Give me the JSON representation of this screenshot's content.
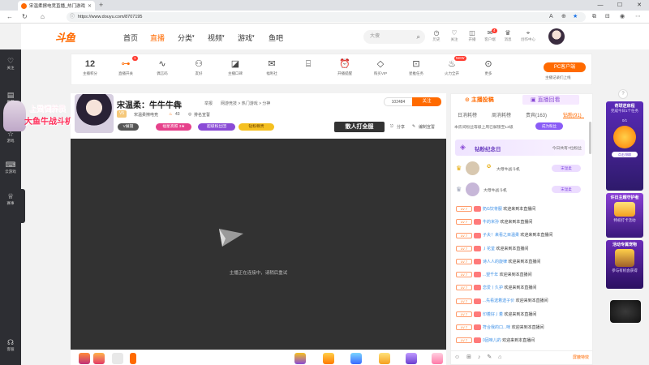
{
  "browser": {
    "tab_title": "宋温柔擦电竞直播_热门游戏兰...",
    "new_tab": "+",
    "url": "https://www.douyu.com/8707195",
    "window_controls": [
      "—",
      "☐",
      "✕"
    ]
  },
  "site": {
    "logo_text": "斗鱼",
    "nav": [
      {
        "label": "首页",
        "active": false
      },
      {
        "label": "直播",
        "active": true
      },
      {
        "label": "分类",
        "active": false
      },
      {
        "label": "视频",
        "active": false
      },
      {
        "label": "游戏",
        "active": false
      },
      {
        "label": "鱼吧",
        "active": false
      }
    ],
    "search_placeholder": "大傻",
    "header_icons": [
      {
        "icon": "history-icon",
        "label": "历史"
      },
      {
        "icon": "heart-icon",
        "label": "关注"
      },
      {
        "icon": "broadcast-icon",
        "label": "开播"
      },
      {
        "icon": "message-icon",
        "label": "客户端",
        "badge": "4"
      },
      {
        "icon": "medal-icon",
        "label": "消息"
      },
      {
        "icon": "location-icon",
        "label": "创作中心"
      }
    ]
  },
  "left_sidebar": [
    {
      "icon": "heart-icon",
      "label": "关注"
    },
    {
      "icon": "document-icon",
      "label": "推荐"
    },
    {
      "icon": "star-icon",
      "label": "游戏"
    },
    {
      "icon": "gamepad-icon",
      "label": "云游戏"
    },
    {
      "icon": "trophy-icon",
      "label": "赛事"
    },
    {
      "icon": "headset-icon",
      "label": "客服"
    }
  ],
  "toolbar": {
    "level": "12",
    "level_label": "主播积分",
    "items": [
      {
        "icon": "toggle-icon",
        "label": "直播开关",
        "badge": "1"
      },
      {
        "icon": "pulse-icon",
        "label": "偶言码"
      },
      {
        "icon": "users-icon",
        "label": "友好"
      },
      {
        "icon": "gift-box-icon",
        "label": "主播口碑"
      },
      {
        "icon": "gift-icon",
        "label": "福利社"
      },
      {
        "icon": "clock-icon",
        "label": "开播提醒"
      },
      {
        "icon": "diamond-icon",
        "label": "购买VIP"
      },
      {
        "icon": "ad-icon",
        "label": "星推任务"
      },
      {
        "icon": "fire-icon",
        "label": "火力全开",
        "badge": "NEW"
      },
      {
        "icon": "more-icon",
        "label": "更多"
      }
    ],
    "pc_client": "PC客户端",
    "pc_sub": "主播记录们上线"
  },
  "promo": {
    "line1": "上周饲养员",
    "line2": "大鱼牛战斗机"
  },
  "streamer": {
    "name": "宋温柔：牛牛牛犇",
    "report": "举报",
    "category": "网游竞技 > 热门游戏 > 分神",
    "tag": "宋温柔擦电竞",
    "fans": "43",
    "medal": "排名宣誓",
    "level_tag": "V5",
    "hot": "102484",
    "follow": "关注",
    "pills": [
      {
        "text": "V展翅",
        "color": "#555"
      },
      {
        "text": "福星高照 3★",
        "color": "#e6418b"
      },
      {
        "text": "超级粉丝团",
        "color": "#8a4bd6"
      },
      {
        "text": "钻粉尊贵",
        "color": "#f5c020"
      }
    ],
    "fan_button": "散人打全服",
    "share": "分享",
    "edit": "编制宣誓"
  },
  "video": {
    "message": "主播正在连接中，请稍后重试"
  },
  "chat": {
    "tabs": [
      "主播投稿",
      "直播回看"
    ],
    "rank_tabs": [
      {
        "label": "日消耗榜",
        "on": false
      },
      {
        "label": "周消耗榜",
        "on": false
      },
      {
        "label": "贵宾(163)",
        "on": false
      },
      {
        "label": "钻粉(91)",
        "on": true
      }
    ],
    "notice": "本房间粉丝等级上周已解锁至13级",
    "notice_btn": "成为粉丝",
    "commem_title": "钻粉纪念日",
    "commem_right": "今日共有7位粉丝",
    "users": [
      {
        "name": "大母牛战斗机",
        "tag": "宋温柔"
      },
      {
        "name": "大母牛战斗机",
        "tag": "宋温柔"
      }
    ],
    "messages": [
      {
        "lv": "LV 7",
        "user": "奶G饮将服",
        "text": "欢迎来到本直播间"
      },
      {
        "lv": "LV 7",
        "user": "牛的米孙",
        "text": "欢迎来到本直播间"
      },
      {
        "lv": "LV 7",
        "user": "子夫！来看之目温柔",
        "text": "欢迎来到本直播间"
      },
      {
        "lv": "LV 7",
        "user": "丿花荃",
        "text": "欢迎来到本直播间"
      },
      {
        "lv": "LV 7",
        "user": "诗人人的旋律",
        "text": "欢迎来到本直播间"
      },
      {
        "lv": "LV 7",
        "user": "...望千年",
        "text": "欢迎来到本直播间"
      },
      {
        "lv": "LV 7",
        "user": "恋爱丨久护",
        "text": "欢迎来到本直播间"
      },
      {
        "lv": "LV 7",
        "user": "...先看送着送子价",
        "text": "欢迎来到本直播间"
      },
      {
        "lv": "LV 7",
        "user": "印着好丿着",
        "text": "欢迎来到本直播间"
      },
      {
        "lv": "LV 7",
        "user": "符合我的口...咪",
        "text": "欢迎来到本直播间"
      },
      {
        "lv": "LV 7",
        "user": "0固味儿的",
        "text": "欢迎来到本直播间"
      }
    ],
    "input_icons": "☺ ⊞ ♪ ✎ ⌂",
    "input_right": "屏蔽特效"
  },
  "right_promos": [
    {
      "title": "奇球逆启程",
      "sub": "完成今日1个任务",
      "prog": "0/1",
      "btn": "点击领取"
    },
    {
      "title": "许日主题守护者",
      "sub": "特权打卡活动",
      "prog": "",
      "btn": ""
    },
    {
      "title": "活动专属宠物",
      "sub": "参与有机会获得",
      "prog": "",
      "btn": ""
    }
  ],
  "colors": {
    "brand": "#ff6a00",
    "purple": "#8a4bd6",
    "dark": "#2d2e33"
  }
}
